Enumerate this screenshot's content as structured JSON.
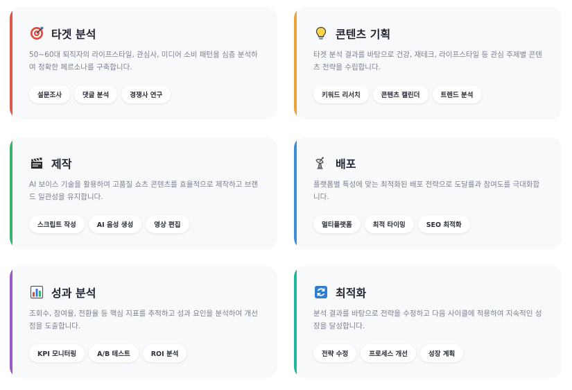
{
  "colors": {
    "red": "#e0574a",
    "orange": "#f0a23a",
    "green": "#3bb36e",
    "blue": "#3c8fd6",
    "purple": "#9b59c7",
    "teal": "#20b79a"
  },
  "cards": [
    {
      "title": "타겟 분석",
      "icon": "target-icon",
      "desc": "50~60대 퇴직자의 라이프스타일, 관심사, 미디어 소비 패턴을 심층 분석하여 정확한 페르소나를 구축합니다.",
      "tags": [
        "설문조사",
        "댓글 분석",
        "경쟁사 연구"
      ]
    },
    {
      "title": "콘텐츠 기획",
      "icon": "lightbulb-icon",
      "desc": "타겟 분석 결과를 바탕으로 건강, 재테크, 라이프스타일 등 관심 주제별 콘텐츠 전략을 수립합니다.",
      "tags": [
        "키워드 리서치",
        "콘텐츠 캘린더",
        "트렌드 분석"
      ]
    },
    {
      "title": "제작",
      "icon": "clapperboard-icon",
      "desc": "AI 보이스 기술을 활용하여 고품질 쇼츠 콘텐츠를 효율적으로 제작하고 브랜드 일관성을 유지합니다.",
      "tags": [
        "스크립트 작성",
        "AI 음성 생성",
        "영상 편집"
      ]
    },
    {
      "title": "배포",
      "icon": "satellite-dish-icon",
      "desc": "플랫폼별 특성에 맞는 최적화된 배포 전략으로 도달률과 참여도를 극대화합니다.",
      "tags": [
        "멀티플랫폼",
        "최적 타이밍",
        "SEO 최적화"
      ]
    },
    {
      "title": "성과 분석",
      "icon": "bar-chart-icon",
      "desc": "조회수, 참여율, 전환율 등 핵심 지표를 추적하고 성과 요인을 분석하여 개선점을 도출합니다.",
      "tags": [
        "KPI 모니터링",
        "A/B 테스트",
        "ROI 분석"
      ]
    },
    {
      "title": "최적화",
      "icon": "refresh-icon",
      "desc": "분석 결과를 바탕으로 전략을 수정하고 다음 사이클에 적용하여 지속적인 성장을 달성합니다.",
      "tags": [
        "전략 수정",
        "프로세스 개선",
        "성장 계획"
      ]
    }
  ]
}
